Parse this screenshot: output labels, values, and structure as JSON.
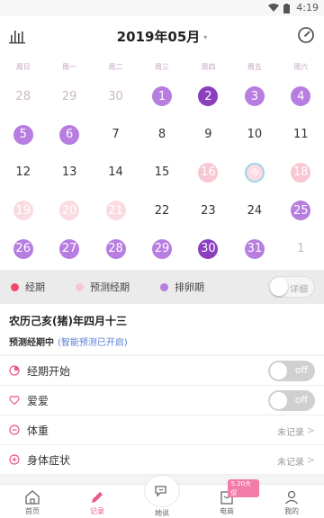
{
  "status": {
    "time": "4:19"
  },
  "header": {
    "month_title": "2019年05月",
    "caret": "▾"
  },
  "weekdays": [
    "周日",
    "周一",
    "周二",
    "周三",
    "周四",
    "周五",
    "周六"
  ],
  "calendar_days": [
    {
      "d": "28",
      "s": "muted"
    },
    {
      "d": "29",
      "s": "muted"
    },
    {
      "d": "30",
      "s": "muted"
    },
    {
      "d": "1",
      "s": "ov"
    },
    {
      "d": "2",
      "s": "ovpeak"
    },
    {
      "d": "3",
      "s": "ov"
    },
    {
      "d": "4",
      "s": "ov"
    },
    {
      "d": "5",
      "s": "ov"
    },
    {
      "d": "6",
      "s": "ov"
    },
    {
      "d": "7",
      "s": ""
    },
    {
      "d": "8",
      "s": ""
    },
    {
      "d": "9",
      "s": ""
    },
    {
      "d": "10",
      "s": ""
    },
    {
      "d": "11",
      "s": ""
    },
    {
      "d": "12",
      "s": ""
    },
    {
      "d": "13",
      "s": ""
    },
    {
      "d": "14",
      "s": ""
    },
    {
      "d": "15",
      "s": ""
    },
    {
      "d": "16",
      "s": "pred"
    },
    {
      "d": "今",
      "s": "today"
    },
    {
      "d": "18",
      "s": "pred"
    },
    {
      "d": "19",
      "s": "pred dim"
    },
    {
      "d": "20",
      "s": "pred dim"
    },
    {
      "d": "21",
      "s": "pred dim"
    },
    {
      "d": "22",
      "s": ""
    },
    {
      "d": "23",
      "s": ""
    },
    {
      "d": "24",
      "s": ""
    },
    {
      "d": "25",
      "s": "ov"
    },
    {
      "d": "26",
      "s": "ov"
    },
    {
      "d": "27",
      "s": "ov"
    },
    {
      "d": "28",
      "s": "ov"
    },
    {
      "d": "29",
      "s": "ov"
    },
    {
      "d": "30",
      "s": "ovpeak"
    },
    {
      "d": "31",
      "s": "ov"
    },
    {
      "d": "1",
      "s": "muted"
    }
  ],
  "legend": {
    "period": "经期",
    "predicted": "预测经期",
    "ovulation": "排卵期",
    "detail_toggle": "详细",
    "colors": {
      "period": "#ef4a6e",
      "predicted": "#f7c7d2",
      "ovulation": "#b77de0"
    }
  },
  "info": {
    "lunar": "农历己亥(猪)年四月十三",
    "predict_label": "预测经期中",
    "predict_link": "(智能预测已开启)"
  },
  "rows": [
    {
      "label": "经期开始",
      "switch": "off"
    },
    {
      "label": "爱爱",
      "switch": "off"
    },
    {
      "label": "体重",
      "value": "未记录"
    },
    {
      "label": "身体症状",
      "value": "未记录"
    }
  ],
  "tabs": {
    "home": "首页",
    "record": "记录",
    "talk": "她说",
    "shop": "电商",
    "mine": "我的",
    "shop_badge": "5.20大促"
  }
}
